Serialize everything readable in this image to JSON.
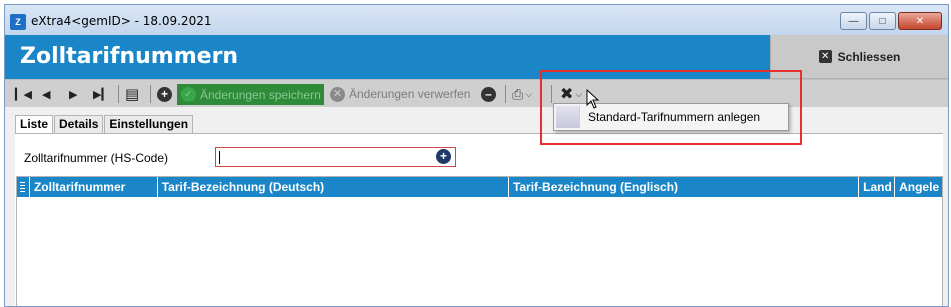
{
  "window": {
    "title": "eXtra4<gemID>  -  18.09.2021",
    "app_icon": "app-logo-icon"
  },
  "header": {
    "title": "Zolltarifnummern",
    "close_label": "Schliessen"
  },
  "toolbar": {
    "save_label": "Änderungen speichern",
    "discard_label": "Änderungen verwerfen"
  },
  "menu": {
    "items": [
      {
        "label": "Standard-Tarifnummern anlegen"
      }
    ]
  },
  "tabs": [
    {
      "label": "Liste",
      "active": true
    },
    {
      "label": "Details",
      "active": false
    },
    {
      "label": "Einstellungen",
      "active": false
    }
  ],
  "filter": {
    "label": "Zolltarifnummer (HS-Code)",
    "value": ""
  },
  "table": {
    "columns": [
      "Zolltarifnummer",
      "Tarif-Bezeichnung (Deutsch)",
      "Tarif-Bezeichnung (Englisch)",
      "Land",
      "Angele"
    ],
    "rows": []
  },
  "colors": {
    "accent": "#1a86c8",
    "save_bg": "#2e8b3a",
    "highlight": "#e53030"
  }
}
